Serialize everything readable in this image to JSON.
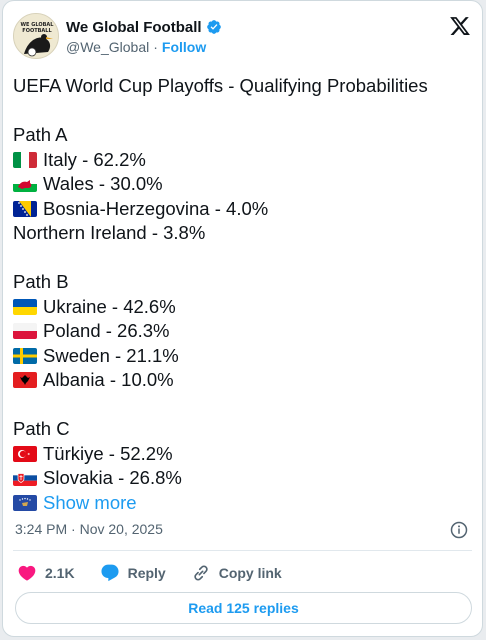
{
  "author": {
    "display_name": "We Global Football",
    "handle": "@We_Global",
    "separator": "·",
    "follow_label": "Follow",
    "avatar_text": "WE GLOBAL FOOTBALL"
  },
  "tweet": {
    "title": "UEFA World Cup Playoffs - Qualifying Probabilities",
    "paths": [
      {
        "name": "Path A",
        "teams": [
          {
            "flag": "italy-flag",
            "text": "Italy - 62.2%"
          },
          {
            "flag": "wales-flag",
            "text": "Wales - 30.0%"
          },
          {
            "flag": "bosnia-flag",
            "text": "Bosnia-Herzegovina - 4.0%"
          },
          {
            "flag": null,
            "text": "Northern Ireland - 3.8%"
          }
        ]
      },
      {
        "name": "Path B",
        "teams": [
          {
            "flag": "ukraine-flag",
            "text": "Ukraine - 42.6%"
          },
          {
            "flag": "poland-flag",
            "text": "Poland - 26.3%"
          },
          {
            "flag": "sweden-flag",
            "text": "Sweden - 21.1%"
          },
          {
            "flag": "albania-flag",
            "text": "Albania - 10.0%"
          }
        ]
      },
      {
        "name": "Path C",
        "teams": [
          {
            "flag": "turkey-flag",
            "text": "Türkiye - 52.2%"
          },
          {
            "flag": "slovakia-flag",
            "text": "Slovakia - 26.8%"
          }
        ]
      }
    ],
    "show_more_flag": "kosovo-flag",
    "show_more_label": "Show more",
    "timestamp": "3:24 PM · Nov 20, 2025"
  },
  "actions": {
    "likes": "2.1K",
    "reply_label": "Reply",
    "copy_link_label": "Copy link",
    "read_replies_label": "Read 125 replies"
  },
  "colors": {
    "accent": "#1d9bf0",
    "like": "#f91880",
    "text": "#0f1419",
    "muted": "#536471"
  }
}
